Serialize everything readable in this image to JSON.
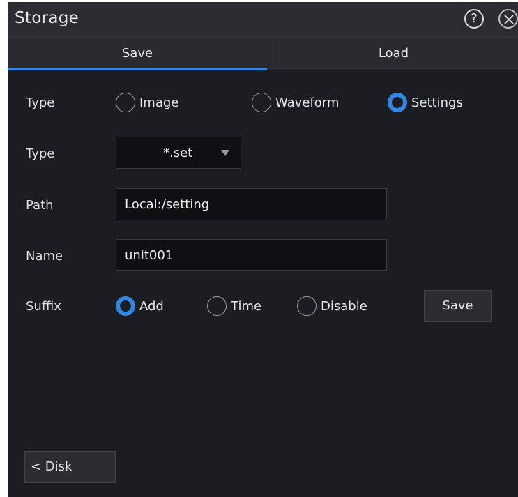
{
  "window": {
    "title": "Storage",
    "help_glyph": "?",
    "close_icon": "close-icon",
    "accent_color": "#2f88e6"
  },
  "tabs": [
    {
      "label": "Save",
      "active": true
    },
    {
      "label": "Load",
      "active": false
    }
  ],
  "form": {
    "type_label": "Type",
    "type_options": [
      {
        "label": "Image",
        "selected": false
      },
      {
        "label": "Waveform",
        "selected": false
      },
      {
        "label": "Settings",
        "selected": true
      }
    ],
    "format_label": "Type",
    "format_value": "*.set",
    "path_label": "Path",
    "path_value": "Local:/setting",
    "name_label": "Name",
    "name_value": "unit001",
    "suffix_label": "Suffix",
    "suffix_options": [
      {
        "label": "Add",
        "selected": true
      },
      {
        "label": "Time",
        "selected": false
      },
      {
        "label": "Disable",
        "selected": false
      }
    ],
    "save_button": "Save"
  },
  "footer": {
    "disk_button": "< Disk"
  }
}
